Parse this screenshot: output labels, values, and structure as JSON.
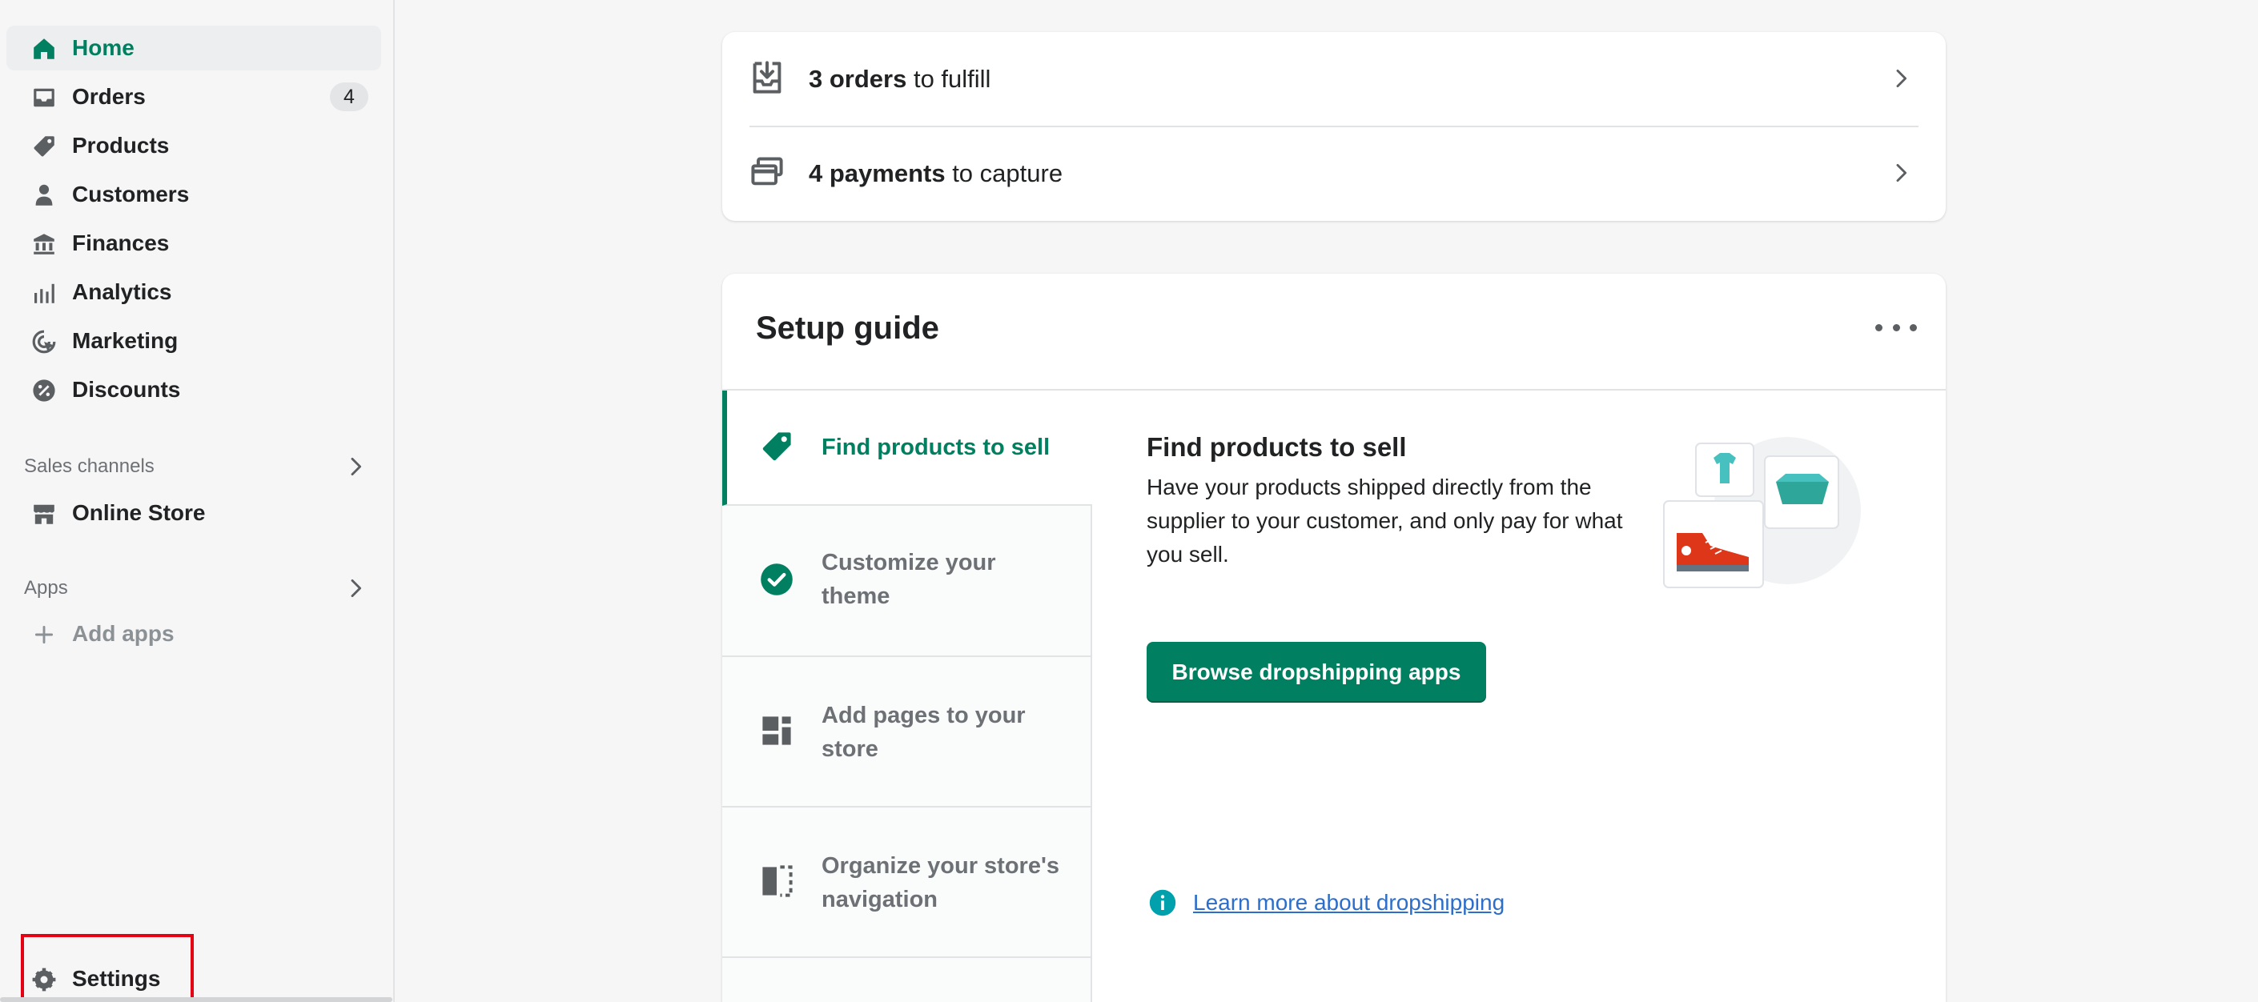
{
  "sidebar": {
    "items": [
      {
        "label": "Home",
        "icon": "home-icon"
      },
      {
        "label": "Orders",
        "icon": "inbox-icon",
        "badge": "4"
      },
      {
        "label": "Products",
        "icon": "tag-icon"
      },
      {
        "label": "Customers",
        "icon": "person-icon"
      },
      {
        "label": "Finances",
        "icon": "bank-icon"
      },
      {
        "label": "Analytics",
        "icon": "bar-chart-icon"
      },
      {
        "label": "Marketing",
        "icon": "target-icon"
      },
      {
        "label": "Discounts",
        "icon": "discount-icon"
      }
    ],
    "sales_channels_title": "Sales channels",
    "online_store_label": "Online Store",
    "apps_title": "Apps",
    "add_apps_label": "Add apps",
    "settings_label": "Settings"
  },
  "tasks": [
    {
      "bold": "3 orders",
      "rest": " to fulfill",
      "icon": "fulfill-icon"
    },
    {
      "bold": "4 payments",
      "rest": " to capture",
      "icon": "payment-icon"
    }
  ],
  "setup": {
    "title": "Setup guide",
    "steps": [
      {
        "label": "Find products to sell",
        "icon": "tag-icon"
      },
      {
        "label": "Customize your theme",
        "icon": "check-circle-icon"
      },
      {
        "label": "Add pages to your store",
        "icon": "pages-icon"
      },
      {
        "label": "Organize your store's navigation",
        "icon": "navigation-icon"
      }
    ],
    "detail": {
      "title": "Find products to sell",
      "body": "Have your products shipped directly from the supplier to your customer, and only pay for what you sell.",
      "button": "Browse dropshipping apps",
      "link": "Learn more about dropshipping"
    }
  },
  "colors": {
    "accent": "#008060",
    "link": "#2c6ecb",
    "highlight": "#e50014"
  }
}
